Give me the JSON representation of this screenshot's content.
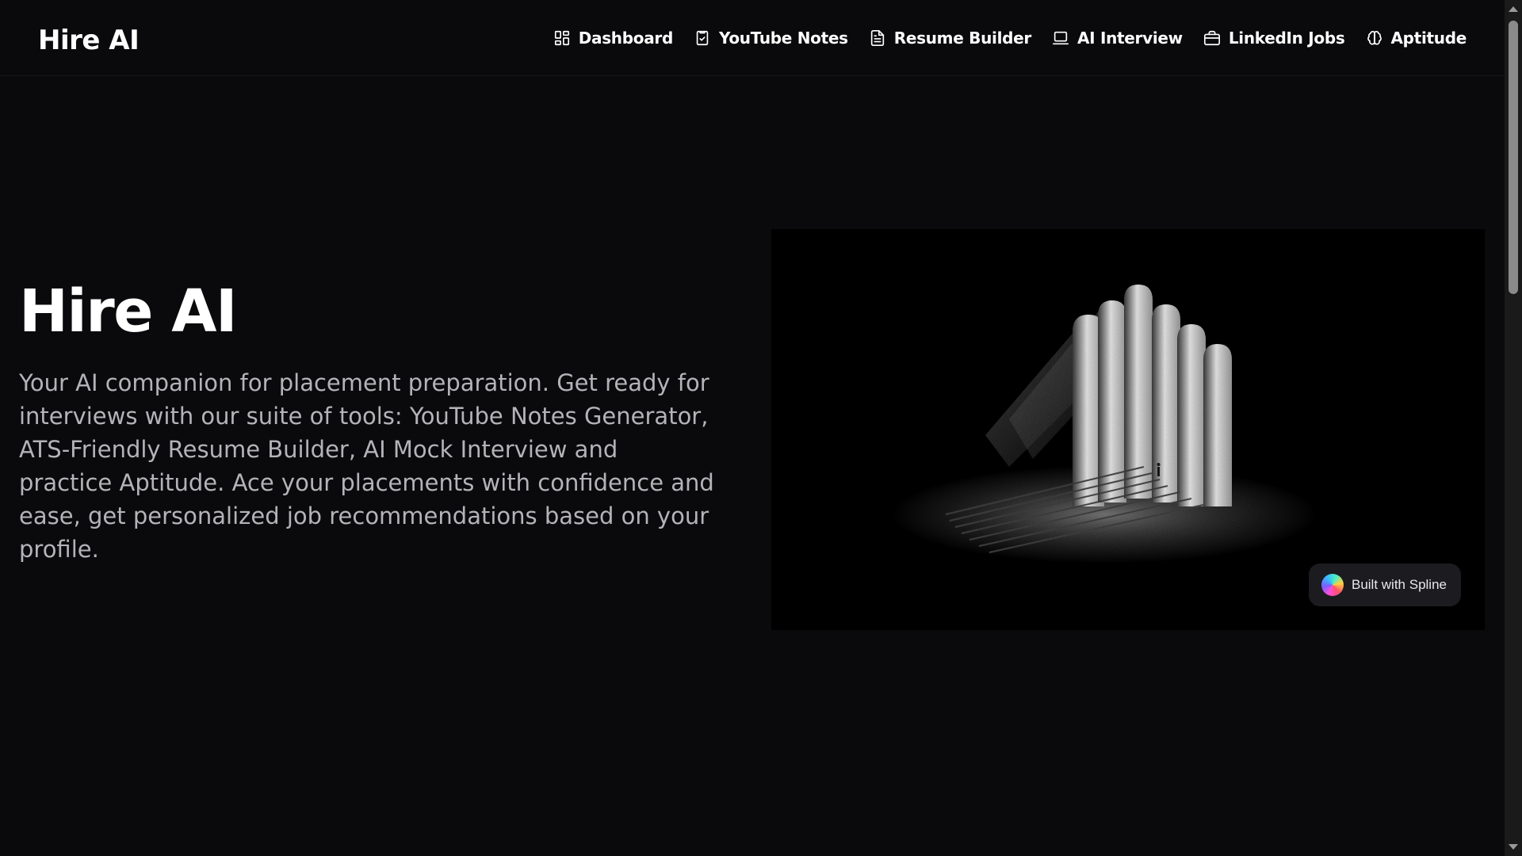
{
  "header": {
    "logo": "Hire AI",
    "nav": [
      {
        "label": "Dashboard",
        "icon": "layout-grid-icon"
      },
      {
        "label": "YouTube Notes",
        "icon": "clipboard-check-icon"
      },
      {
        "label": "Resume Builder",
        "icon": "file-text-icon"
      },
      {
        "label": "AI Interview",
        "icon": "laptop-icon"
      },
      {
        "label": "LinkedIn Jobs",
        "icon": "briefcase-icon"
      },
      {
        "label": "Aptitude",
        "icon": "brain-icon"
      }
    ]
  },
  "hero": {
    "title": "Hire AI",
    "description": "Your AI companion for placement preparation. Get ready for interviews with our suite of tools: YouTube Notes Generator, ATS-Friendly Resume Builder, AI Mock Interview and practice Aptitude. Ace your placements with confidence and ease, get personalized job recommendations based on your profile."
  },
  "spline": {
    "badge_label": "Built with Spline"
  },
  "colors": {
    "background": "#0a0a0c",
    "text": "#ffffff",
    "muted_text": "#b4b4b8",
    "badge_bg": "#1c1c20"
  }
}
